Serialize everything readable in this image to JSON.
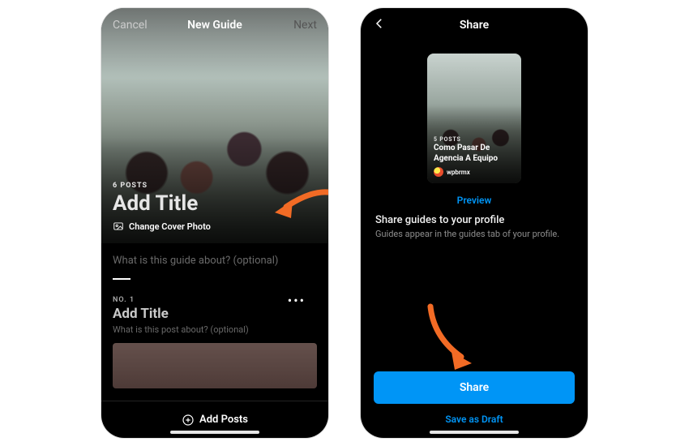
{
  "left": {
    "nav": {
      "cancel": "Cancel",
      "title": "New Guide",
      "next": "Next"
    },
    "hero": {
      "posts_count": "6 POSTS",
      "title_placeholder": "Add Title",
      "change_cover": "Change Cover Photo"
    },
    "about_placeholder": "What is this guide about? (optional)",
    "post": {
      "index": "NO. 1",
      "title_placeholder": "Add Title",
      "sub_placeholder": "What is this post about? (optional)"
    },
    "add_posts": "Add Posts"
  },
  "right": {
    "nav": {
      "title": "Share"
    },
    "card": {
      "posts_count": "5 POSTS",
      "title": "Como Pasar De Agencia A Equipo",
      "username": "wpbrmx"
    },
    "preview": "Preview",
    "share_heading": "Share guides to your profile",
    "share_sub": "Guides appear in the guides tab of your profile.",
    "share_button": "Share",
    "save_draft": "Save as Draft"
  }
}
